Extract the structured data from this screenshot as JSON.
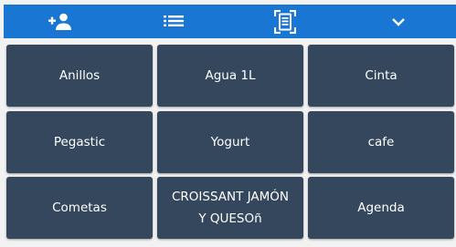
{
  "toolbar": {
    "icons": [
      "add-person-icon",
      "list-icon",
      "receipt-scan-icon",
      "chevron-down-icon"
    ],
    "background": "#1976d2",
    "icon_color": "#ffffff"
  },
  "products": [
    {
      "label": "Anillos"
    },
    {
      "label": "Agua 1L"
    },
    {
      "label": "Cinta"
    },
    {
      "label": "Pegastic"
    },
    {
      "label": "Yogurt"
    },
    {
      "label": "cafe"
    },
    {
      "label": "Cometas"
    },
    {
      "label": "CROISSANT JAMÓN Y QUESOñ"
    },
    {
      "label": "Agenda"
    }
  ],
  "colors": {
    "tile": "#34475c",
    "tile_text": "#ffffff",
    "page_background": "#f2f2f2"
  }
}
